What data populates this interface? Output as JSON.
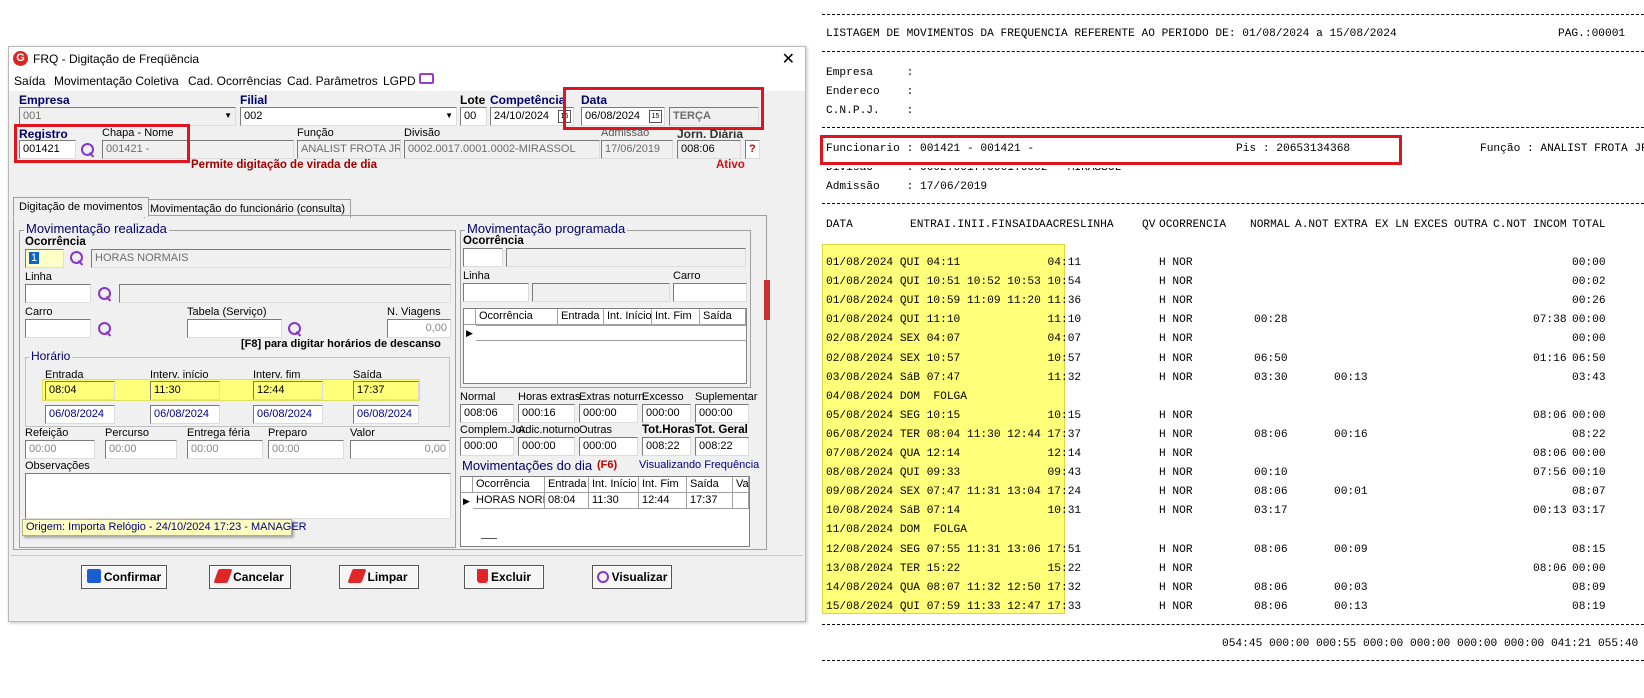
{
  "window": {
    "title": "FRQ - Digitação de Freqüência",
    "logo_text": "G",
    "close_glyph": "✕",
    "menu": [
      "Saída",
      "Movimentação Coletiva",
      "Cad. Ocorrências",
      "Cad. Parâmetros",
      "LGPD"
    ]
  },
  "header": {
    "empresa_label": "Empresa",
    "empresa_value": "001",
    "filial_label": "Filial",
    "filial_value": "002",
    "lote_label": "Lote",
    "lote_value": "00",
    "competencia_label": "Competência",
    "competencia_value": "24/10/2024",
    "data_label": "Data",
    "data_value": "06/08/2024",
    "weekday": "TERÇA",
    "registro_label": "Registro",
    "registro_value": "001421",
    "chapa_label": "Chapa - Nome",
    "chapa_value": "001421 -",
    "funcao_label": "Função",
    "funcao_value": "ANALIST FROTA JR",
    "divisao_label": "Divisão",
    "divisao_value": "0002.0017.0001.0002-MIRASSOL",
    "admissao_label": "Admissão",
    "admissao_value": "17/06/2019",
    "jornada_label": "Jorn. Diária",
    "jornada_value": "008:06",
    "help": "?",
    "virada_msg": "Permite digitação de virada de dia",
    "status": "Ativo",
    "cal_icon": "15"
  },
  "tabs": [
    "Digitação de movimentos",
    "Movimentação do funcionário (consulta)"
  ],
  "realizada": {
    "title": "Movimentação realizada",
    "ocorrencia_label": "Ocorrência",
    "ocorrencia_code": "1",
    "ocorrencia_desc": "HORAS NORMAIS",
    "linha_label": "Linha",
    "carro_label": "Carro",
    "tabela_label": "Tabela (Serviço)",
    "viagens_label": "N. Viagens",
    "viagens_value": "0,00",
    "f8_hint": "[F8] para digitar horários de descanso",
    "horario_title": "Horário",
    "horario_labels": [
      "Entrada",
      "Interv. início",
      "Interv. fim",
      "Saída"
    ],
    "horario_times": [
      "08:04",
      "11:30",
      "12:44",
      "17:37"
    ],
    "horario_dates": [
      "06/08/2024",
      "06/08/2024",
      "06/08/2024",
      "06/08/2024"
    ],
    "extra_labels": [
      "Refeição",
      "Percurso",
      "Entrega féria",
      "Preparo",
      "Valor"
    ],
    "extra_values": [
      "00:00",
      "00:00",
      "00:00",
      "00:00",
      "0,00"
    ],
    "obs_label": "Observações",
    "origem": "Origem: Importa Relógio - 24/10/2024 17:23 - MANAGER"
  },
  "programada": {
    "title": "Movimentação programada",
    "ocorrencia_label": "Ocorrência",
    "linha_label": "Linha",
    "carro_label": "Carro",
    "grid_headers": [
      "Ocorrência",
      "Entrada",
      "Int. Início",
      "Int. Fim",
      "Saída"
    ]
  },
  "totais": {
    "row1_labels": [
      "Normal",
      "Horas extras",
      "Extras noturn.",
      "Excesso",
      "Suplementar"
    ],
    "row1_values": [
      "008:06",
      "000:16",
      "000:00",
      "000:00",
      "000:00"
    ],
    "row2_labels": [
      "Complem.Jor.",
      "Adic.noturno",
      "Outras",
      "Tot.Horas",
      "Tot. Geral"
    ],
    "row2_values": [
      "000:00",
      "000:00",
      "000:00",
      "008:22",
      "008:22"
    ]
  },
  "dia": {
    "title": "Movimentações do dia",
    "f6": "(F6)",
    "visualizando": "Visualizando Frequência",
    "grid_headers": [
      "Ocorrência",
      "Entrada",
      "Int. Início",
      "Int. Fim",
      "Saída",
      "Va"
    ],
    "row": [
      "HORAS NORM",
      "08:04",
      "11:30",
      "12:44",
      "17:37",
      ""
    ]
  },
  "buttons": {
    "confirmar": "Confirmar",
    "cancelar": "Cancelar",
    "limpar": "Limpar",
    "excluir": "Excluir",
    "visualizar": "Visualizar"
  },
  "report": {
    "title_line": "LISTAGEM DE MOVIMENTOS DA FREQUENCIA REFERENTE AO PERIODO DE: 01/08/2024 a 15/08/2024",
    "page": "PAG.:00001",
    "empresa": "Empresa     :",
    "endereco": "Endereco    :",
    "cnpj": "C.N.P.J.    :",
    "funcionario": "Funcionario : 001421 - 001421 -",
    "pis": "Pis : 20653134368",
    "funcao": "Função : ANALIST FROTA JR",
    "divisao": "Divisao     : 0002.0017.0001.0002 - MIRASSOL",
    "admissao": "Admissão    : 17/06/2019",
    "columns": [
      "DATA",
      "ENTRA",
      "I.INI",
      "I.FIN",
      "SAIDA",
      "ACRES",
      "LINHA",
      "QV",
      "OCORRENCIA",
      "NORMAL",
      "A.NOT",
      "EXTRA",
      "EX LN",
      "EXCES",
      "OUTRA",
      "C.NOT",
      "INCOM",
      "TOTAL"
    ],
    "rows": [
      {
        "left": "01/08/2024 QUI 04:11             04:11",
        "oc": "H NOR",
        "normal": "",
        "extra": "",
        "incom": "",
        "total": "00:00"
      },
      {
        "left": "01/08/2024 QUI 10:51 10:52 10:53 10:54",
        "oc": "H NOR",
        "normal": "",
        "extra": "",
        "incom": "",
        "total": "00:02"
      },
      {
        "left": "01/08/2024 QUI 10:59 11:09 11:20 11:36",
        "oc": "H NOR",
        "normal": "",
        "extra": "",
        "incom": "",
        "total": "00:26"
      },
      {
        "left": "01/08/2024 QUI 11:10             11:10",
        "oc": "H NOR",
        "normal": "00:28",
        "extra": "",
        "incom": "07:38",
        "total": "00:00"
      },
      {
        "left": "02/08/2024 SEX 04:07             04:07",
        "oc": "H NOR",
        "normal": "",
        "extra": "",
        "incom": "",
        "total": "00:00"
      },
      {
        "left": "02/08/2024 SEX 10:57             10:57",
        "oc": "H NOR",
        "normal": "06:50",
        "extra": "",
        "incom": "01:16",
        "total": "06:50"
      },
      {
        "left": "03/08/2024 SáB 07:47             11:32",
        "oc": "H NOR",
        "normal": "03:30",
        "extra": "00:13",
        "incom": "",
        "total": "03:43"
      },
      {
        "left": "04/08/2024 DOM  FOLGA",
        "oc": "",
        "normal": "",
        "extra": "",
        "incom": "",
        "total": ""
      },
      {
        "left": "05/08/2024 SEG 10:15             10:15",
        "oc": "H NOR",
        "normal": "",
        "extra": "",
        "incom": "08:06",
        "total": "00:00"
      },
      {
        "left": "06/08/2024 TER 08:04 11:30 12:44 17:37",
        "oc": "H NOR",
        "normal": "08:06",
        "extra": "00:16",
        "incom": "",
        "total": "08:22"
      },
      {
        "left": "07/08/2024 QUA 12:14             12:14",
        "oc": "H NOR",
        "normal": "",
        "extra": "",
        "incom": "08:06",
        "total": "00:00"
      },
      {
        "left": "08/08/2024 QUI 09:33             09:43",
        "oc": "H NOR",
        "normal": "00:10",
        "extra": "",
        "incom": "07:56",
        "total": "00:10"
      },
      {
        "left": "09/08/2024 SEX 07:47 11:31 13:04 17:24",
        "oc": "H NOR",
        "normal": "08:06",
        "extra": "00:01",
        "incom": "",
        "total": "08:07"
      },
      {
        "left": "10/08/2024 SáB 07:14             10:31",
        "oc": "H NOR",
        "normal": "03:17",
        "extra": "",
        "incom": "00:13",
        "total": "03:17"
      },
      {
        "left": "11/08/2024 DOM  FOLGA",
        "oc": "",
        "normal": "",
        "extra": "",
        "incom": "",
        "total": ""
      },
      {
        "left": "12/08/2024 SEG 07:55 11:31 13:06 17:51",
        "oc": "H NOR",
        "normal": "08:06",
        "extra": "00:09",
        "incom": "",
        "total": "08:15"
      },
      {
        "left": "13/08/2024 TER 15:22             15:22",
        "oc": "H NOR",
        "normal": "",
        "extra": "",
        "incom": "08:06",
        "total": "00:00"
      },
      {
        "left": "14/08/2024 QUA 08:07 11:32 12:50 17:32",
        "oc": "H NOR",
        "normal": "08:06",
        "extra": "00:03",
        "incom": "",
        "total": "08:09"
      },
      {
        "left": "15/08/2024 QUI 07:59 11:33 12:47 17:33",
        "oc": "H NOR",
        "normal": "08:06",
        "extra": "00:13",
        "incom": "",
        "total": "08:19"
      }
    ],
    "totals_line": "054:45 000:00 000:55 000:00 000:00 000:00 000:00 041:21 055:40"
  }
}
